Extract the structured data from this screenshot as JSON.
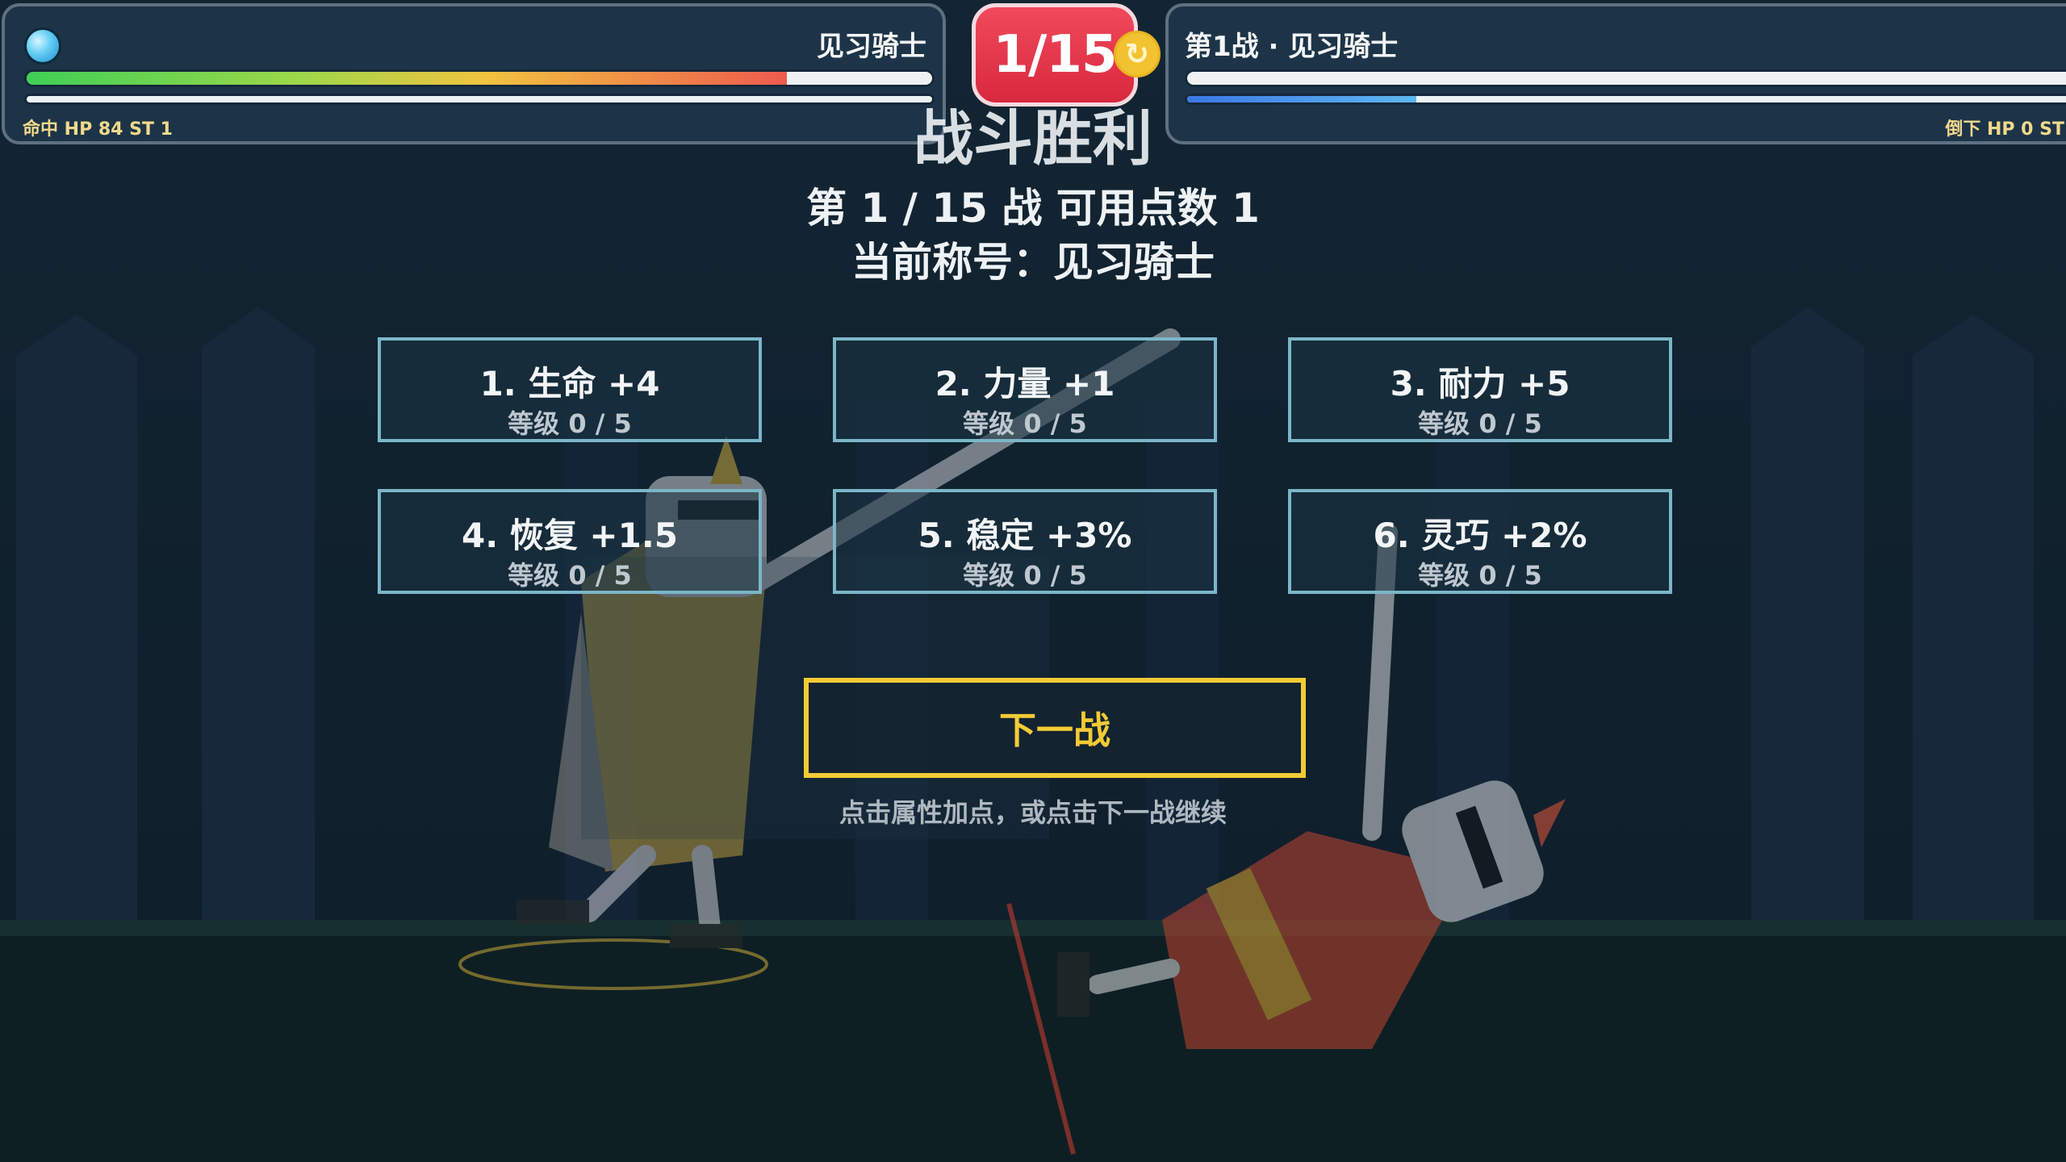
{
  "hud": {
    "left": {
      "name": "见习骑士",
      "stats": "命中 HP 84 ST 1",
      "hp_fraction": 0.84,
      "st_fraction": 0.0
    },
    "right": {
      "name": "第1战 · 见习骑士",
      "stats": "倒下 HP 0 ST",
      "hp_fraction": 0.0,
      "st_fraction": 0.25
    },
    "round_badge": "1/15",
    "refresh_icon": "↻"
  },
  "overlay": {
    "victory_title": "战斗胜利",
    "battle_line": "第 1 / 15 战  可用点数 1",
    "title_line": "当前称号：见习骑士",
    "upgrades": [
      {
        "name": "1. 生命 +4",
        "level": "等级 0 / 5"
      },
      {
        "name": "2. 力量 +1",
        "level": "等级 0 / 5"
      },
      {
        "name": "3. 耐力 +5",
        "level": "等级 0 / 5"
      },
      {
        "name": "4. 恢复 +1.5",
        "level": "等级 0 / 5"
      },
      {
        "name": "5. 稳定 +3%",
        "level": "等级 0 / 5"
      },
      {
        "name": "6. 灵巧 +2%",
        "level": "等级 0 / 5"
      }
    ],
    "next_button": "下一战",
    "hint": "点击属性加点，或点击下一战继续"
  },
  "colors": {
    "background": "#10202d",
    "accent_gold": "#f2cb35",
    "badge_red": "#e0354a",
    "panel_border": "#7bb6c8",
    "player_cape": "#c9a23a",
    "enemy_cape": "#b2412f"
  },
  "icons": [
    "player-orb-icon",
    "refresh-icon",
    "player-knight-sprite",
    "enemy-knight-sprite"
  ]
}
